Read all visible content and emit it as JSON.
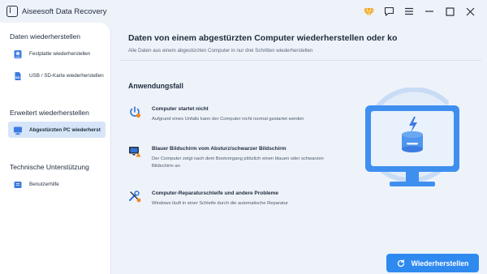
{
  "app": {
    "title": "Aiseesoft Data Recovery"
  },
  "titlebar": {
    "icons": [
      "diamond-icon",
      "chat-icon",
      "menu-icon",
      "minimize-icon",
      "maximize-icon",
      "close-icon"
    ]
  },
  "sidebar": {
    "sections": [
      {
        "title": "Daten wiederherstellen",
        "items": [
          {
            "label": "Festplatte wiederherstellen",
            "icon": "hard-drive-icon",
            "active": false
          },
          {
            "label": "USB / SD-Karte wiederherstellen",
            "icon": "usb-sd-icon",
            "active": false
          }
        ]
      },
      {
        "title": "Erweitert wiederherstellen",
        "items": [
          {
            "label": "Abgestürzten PC wiederherst",
            "icon": "crashed-pc-icon",
            "active": true
          }
        ]
      },
      {
        "title": "Technische Unterstützung",
        "items": [
          {
            "label": "Benutzerhilfe",
            "icon": "help-book-icon",
            "active": false
          }
        ]
      }
    ]
  },
  "main": {
    "title": "Daten von einem abgestürzten Computer wiederherstellen oder ko",
    "subtitle": "Alle Daten aus einem abgestürzten Computer in nur drei Schritten wiederherstellen",
    "section_title": "Anwendungsfall",
    "cases": [
      {
        "title": "Computer startet nicht",
        "desc": "Aufgrund eines Unfalls kann der Computer nicht normal gestartet werden",
        "icon": "power-icon"
      },
      {
        "title": "Blauer Bildschirm vom Absturz/schwarzer Bildschirm",
        "desc": "Der Computer zeigt nach dem Bootvorgang plötzlich einen blauen oder schwarzen Bildschirm an",
        "icon": "monitor-warning-icon"
      },
      {
        "title": "Computer-Reparaturschleife und andere Probleme",
        "desc": "Windows läuft in einer Schleife durch die automatische Reparatur",
        "icon": "tools-icon"
      }
    ]
  },
  "action": {
    "recover_label": "Wiederherstellen"
  },
  "colors": {
    "accent": "#2f8af0",
    "sidebar_active": "#d7e5f8",
    "background": "#eef3fa",
    "warning": "#f08a24"
  }
}
